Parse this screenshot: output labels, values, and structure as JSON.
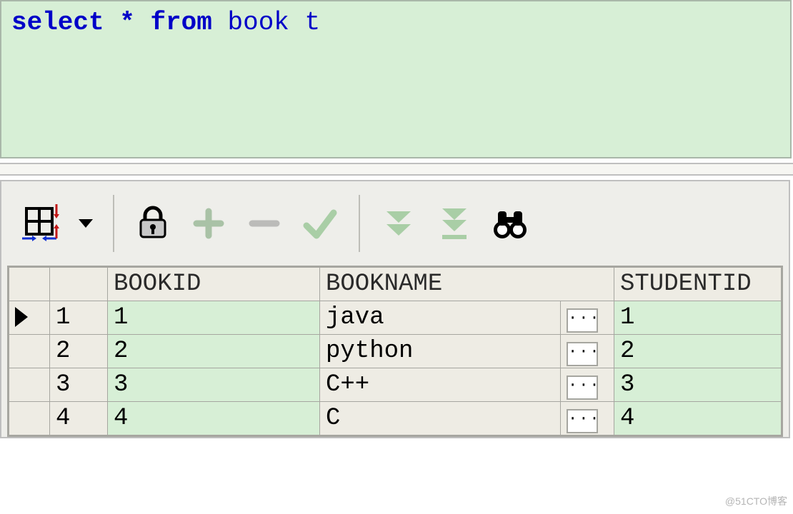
{
  "sql": {
    "keyword_select": "select",
    "star": "*",
    "keyword_from": "from",
    "table": "book",
    "alias": "t"
  },
  "toolbar": {
    "grid_icon": "grid-toggle-icon",
    "dropdown_icon": "chevron-down-icon",
    "lock_icon": "lock-icon",
    "plus_icon": "plus-icon",
    "minus_icon": "minus-icon",
    "check_icon": "check-icon",
    "fetch_icon": "double-chevron-down-icon",
    "fetch_all_icon": "double-chevron-down-bar-icon",
    "find_icon": "binoculars-icon"
  },
  "columns": {
    "bookid": "BOOKID",
    "bookname": "BOOKNAME",
    "studentid": "STUDENTID"
  },
  "cell_button_label": "···",
  "rows": [
    {
      "current": true,
      "n": "1",
      "bookid": "1",
      "bookname": "java",
      "studentid": "1"
    },
    {
      "current": false,
      "n": "2",
      "bookid": "2",
      "bookname": "python",
      "studentid": "2"
    },
    {
      "current": false,
      "n": "3",
      "bookid": "3",
      "bookname": "C++",
      "studentid": "3"
    },
    {
      "current": false,
      "n": "4",
      "bookid": "4",
      "bookname": "C",
      "studentid": "4"
    }
  ],
  "watermark": "@51CTO博客"
}
